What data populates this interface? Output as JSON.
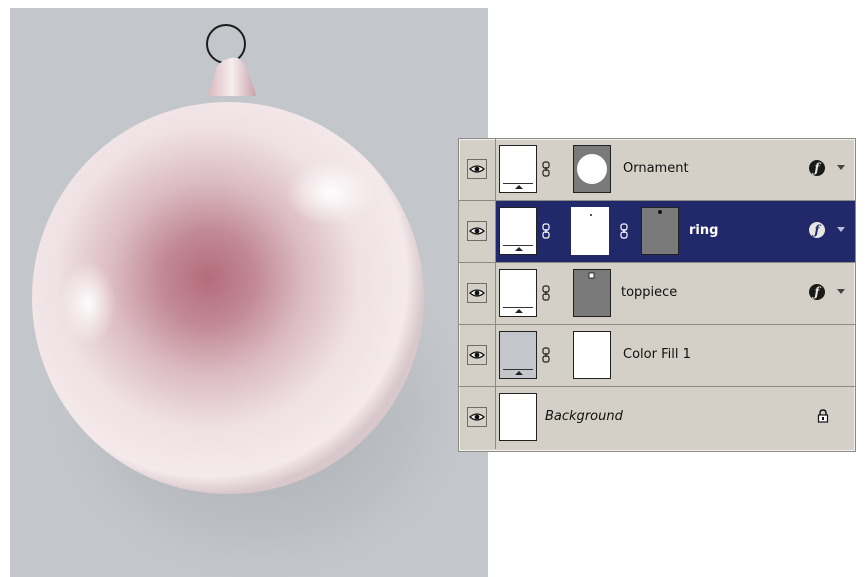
{
  "canvas": {
    "background_color": "#c3c6ca",
    "ornament_color": "#f2e6e8",
    "ornament_glow_color": "#b56a7a"
  },
  "layers_panel": {
    "layers": [
      {
        "name": "Ornament",
        "selected": false,
        "has_fx": true,
        "locked": false,
        "visible": true
      },
      {
        "name": "ring",
        "selected": true,
        "has_fx": true,
        "locked": false,
        "visible": true
      },
      {
        "name": "toppiece",
        "selected": false,
        "has_fx": true,
        "locked": false,
        "visible": true
      },
      {
        "name": "Color Fill 1",
        "selected": false,
        "has_fx": false,
        "locked": false,
        "visible": true
      },
      {
        "name": "Background",
        "selected": false,
        "has_fx": false,
        "locked": true,
        "visible": true
      }
    ],
    "fx_symbol": "ƒ",
    "selection_color": "#22296b"
  }
}
